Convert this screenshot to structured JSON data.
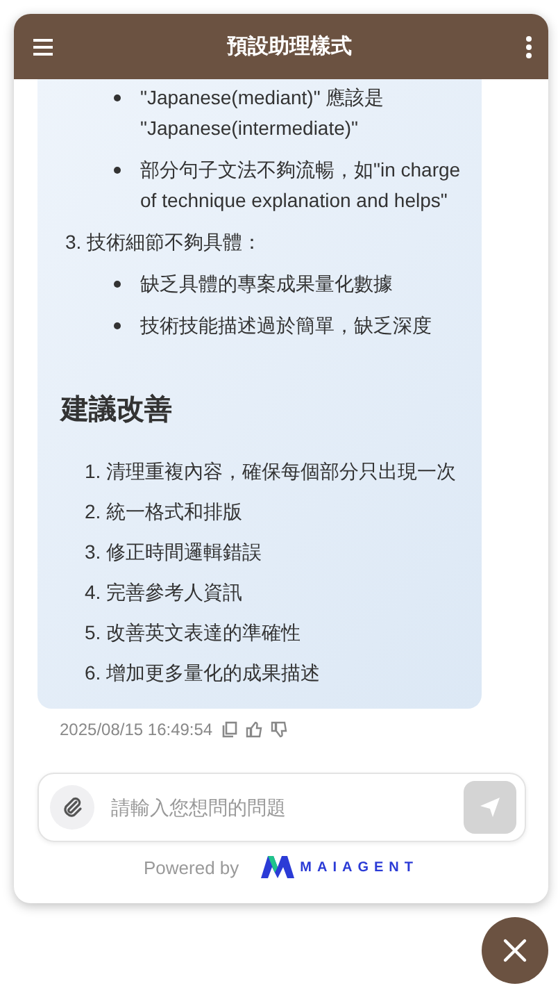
{
  "header": {
    "title": "預設助理樣式"
  },
  "message": {
    "top_bullets": [
      "\"Japanese(mediant)\" 應該是 \"Japanese(intermediate)\"",
      "部分句子文法不夠流暢，如\"in charge of technique explanation and helps\""
    ],
    "numbered_items": [
      {
        "number": "3.",
        "text": "技術細節不夠具體：",
        "children": [
          "缺乏具體的專案成果量化數據",
          "技術技能描述過於簡單，缺乏深度"
        ]
      }
    ],
    "heading": "建議改善",
    "suggestions": [
      {
        "number": "1.",
        "text": "清理重複內容，確保每個部分只出現一次"
      },
      {
        "number": "2.",
        "text": "統一格式和排版"
      },
      {
        "number": "3.",
        "text": "修正時間邏輯錯誤"
      },
      {
        "number": "4.",
        "text": "完善參考人資訊"
      },
      {
        "number": "5.",
        "text": "改善英文表達的準確性"
      },
      {
        "number": "6.",
        "text": "增加更多量化的成果描述"
      }
    ],
    "timestamp": "2025/08/15 16:49:54"
  },
  "input": {
    "placeholder": "請輸入您想問的問題"
  },
  "footer": {
    "powered_by": "Powered by",
    "brand": "MAIAGENT"
  }
}
